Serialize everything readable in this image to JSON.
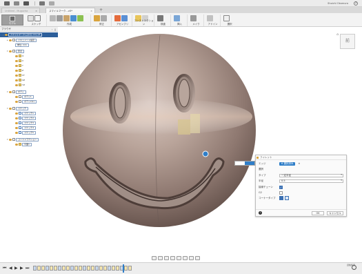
{
  "titlebar": {
    "user": "Shoichi Okamura",
    "help": "?"
  },
  "tabs": [
    {
      "label": "Untitled - Mugucha",
      "active": false
    },
    {
      "label": "スマイルマーク…v5*",
      "active": true
    }
  ],
  "ribbon": {
    "workspace": "モデル",
    "groups": [
      "スケッチ",
      "作成",
      "修正",
      "アセンブリ",
      "コンストラクション",
      "検査",
      "挿入",
      "メイク",
      "アドイン",
      "選択"
    ]
  },
  "browser": {
    "title": "ブラウザ",
    "root": "スマイルマーク(ゴタガ ≈m) v5",
    "items": [
      {
        "label": "ドキュメント設定",
        "indent": 1,
        "type": "folder"
      },
      {
        "label": "単位: mm",
        "indent": 2,
        "type": "tag"
      },
      {
        "label": "原点",
        "indent": 1,
        "type": "folder"
      },
      {
        "label": "O",
        "indent": 2,
        "type": "item"
      },
      {
        "label": "X",
        "indent": 2,
        "type": "item"
      },
      {
        "label": "Y",
        "indent": 2,
        "type": "item"
      },
      {
        "label": "Z",
        "indent": 2,
        "type": "item"
      },
      {
        "label": "XY",
        "indent": 2,
        "type": "item"
      },
      {
        "label": "XZ",
        "indent": 2,
        "type": "item"
      },
      {
        "label": "YZ",
        "indent": 2,
        "type": "item"
      },
      {
        "label": "ボディ",
        "indent": 1,
        "type": "folder"
      },
      {
        "label": "ボディ1",
        "indent": 2,
        "type": "item"
      },
      {
        "label": "ボディ2(1)",
        "indent": 2,
        "type": "item"
      },
      {
        "label": "スケッチ",
        "indent": 1,
        "type": "folder"
      },
      {
        "label": "スケッチ1",
        "indent": 2,
        "type": "item"
      },
      {
        "label": "スケッチ2",
        "indent": 2,
        "type": "item"
      },
      {
        "label": "スケッチ3",
        "indent": 2,
        "type": "item"
      },
      {
        "label": "スケッチ4",
        "indent": 2,
        "type": "item"
      },
      {
        "label": "スケッチ5",
        "indent": 2,
        "type": "item"
      },
      {
        "label": "コンストラクション",
        "indent": 1,
        "type": "folder"
      },
      {
        "label": "平面1",
        "indent": 2,
        "type": "item"
      }
    ]
  },
  "viewcube": {
    "face": "前"
  },
  "dialog": {
    "title": "フィレット",
    "edges_label": "エッジ",
    "edges_value": "6 選択済み",
    "clear_glyph": "✕",
    "rows": [
      {
        "label": "タイプ",
        "value": "一定半径"
      },
      {
        "label": "半径",
        "value": "0.5"
      },
      {
        "label": "接線チェーン",
        "value": "✓"
      },
      {
        "label": "G2",
        "value": ""
      },
      {
        "label": "コーナータイプ",
        "value": ""
      }
    ],
    "section": "選択",
    "ok": "OK",
    "cancel": "キャンセル",
    "info": "i"
  },
  "timeline": {
    "items": 24,
    "marker_fraction": 0.85,
    "right_text": "資格情報"
  },
  "colors": {
    "accent": "#2f7ec8",
    "ribbon_bg": "#f3f3f3",
    "tree_root": "#2d5f9a"
  }
}
